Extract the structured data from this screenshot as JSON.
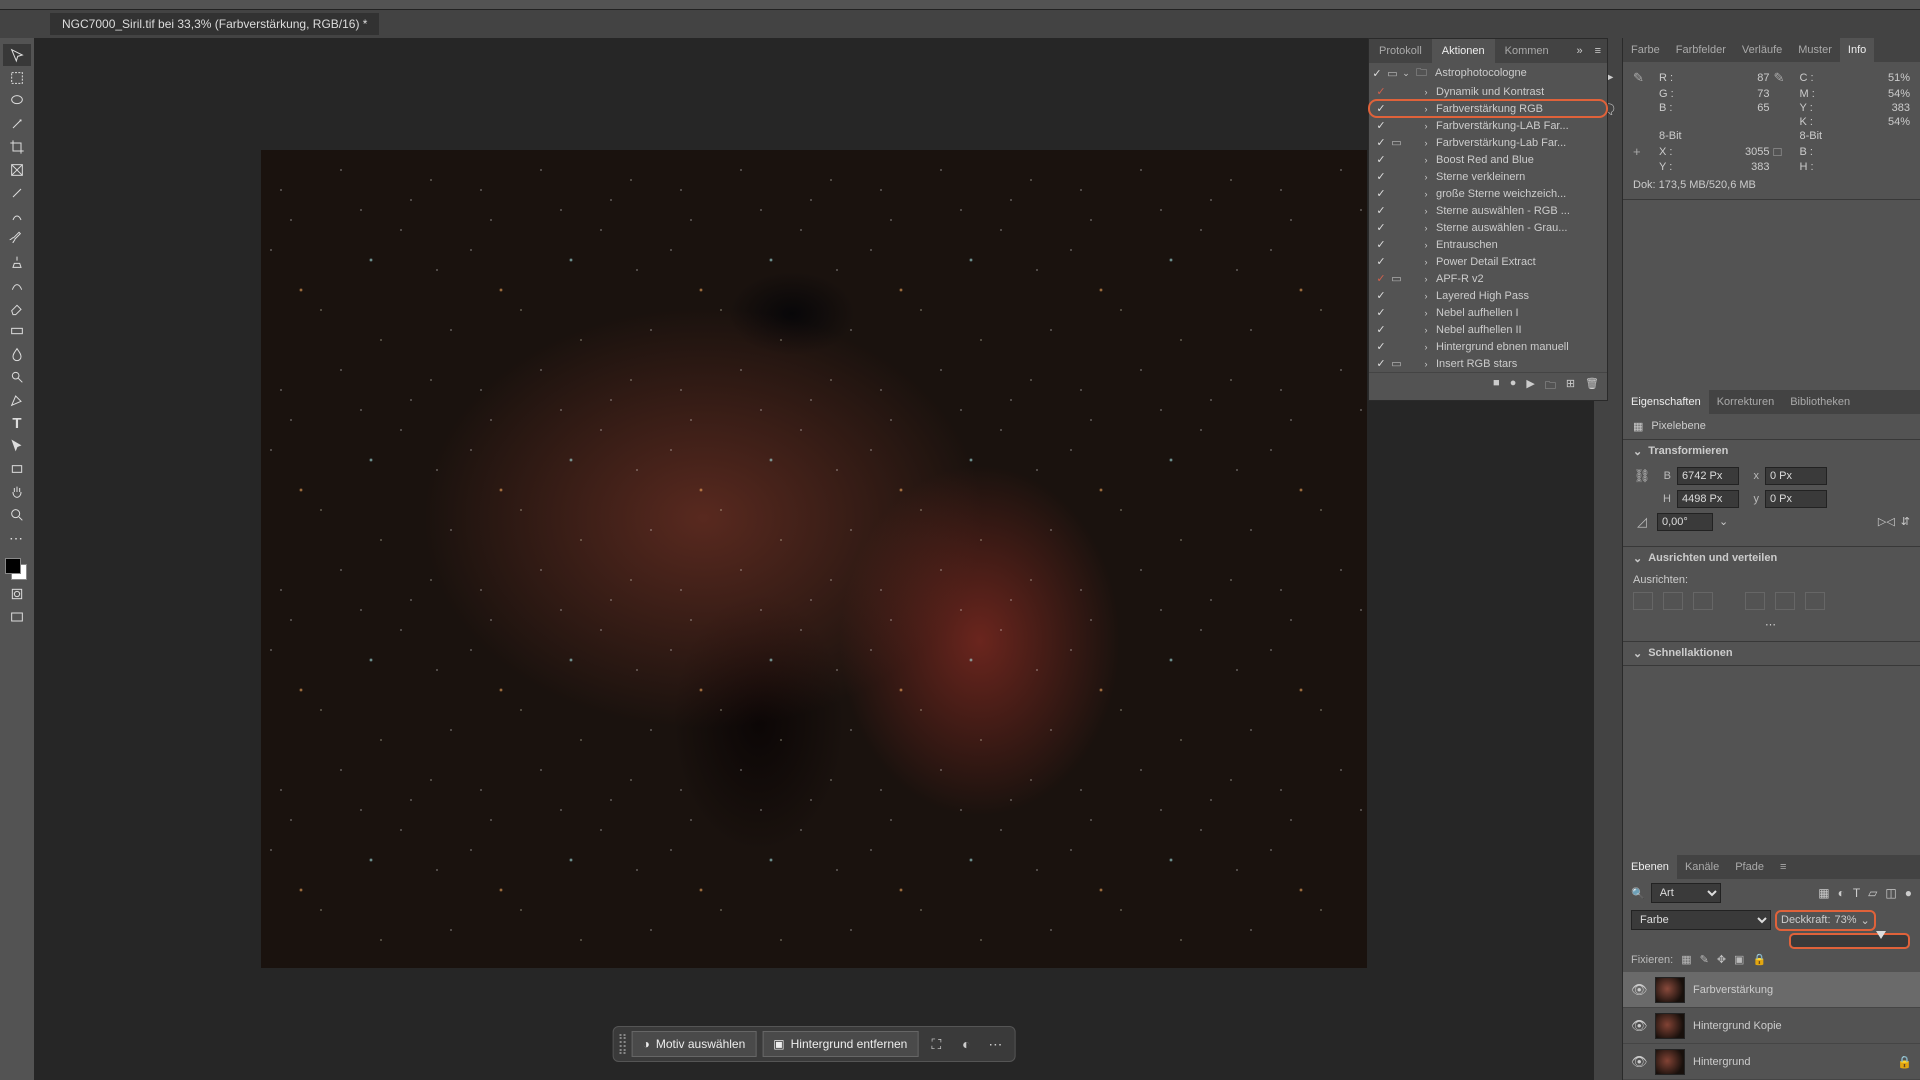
{
  "tab_title": "NGC7000_Siril.tif bei 33,3% (Farbverstärkung, RGB/16) *",
  "actions": {
    "tabs": {
      "protokoll": "Protokoll",
      "aktionen": "Aktionen",
      "kommen": "Kommen"
    },
    "group": "Astrophotocologne",
    "items": [
      {
        "label": "Dynamik und Kontrast",
        "red_check": true
      },
      {
        "label": "Farbverstärkung RGB",
        "highlight": true
      },
      {
        "label": "Farbverstärkung-LAB Far..."
      },
      {
        "label": "Farbverstärkung-Lab Far...",
        "mode": true
      },
      {
        "label": "Boost Red and Blue"
      },
      {
        "label": "Sterne verkleinern"
      },
      {
        "label": "große Sterne weichzeich..."
      },
      {
        "label": "Sterne auswählen - RGB ..."
      },
      {
        "label": "Sterne auswählen - Grau..."
      },
      {
        "label": "Entrauschen"
      },
      {
        "label": "Power Detail Extract"
      },
      {
        "label": "APF-R v2",
        "red_check": true,
        "mode": true
      },
      {
        "label": "Layered High Pass"
      },
      {
        "label": "Nebel aufhellen I"
      },
      {
        "label": "Nebel aufhellen II"
      },
      {
        "label": "Hintergrund ebnen manuell"
      },
      {
        "label": "Insert RGB stars",
        "mode": true
      }
    ]
  },
  "color_tabs": {
    "farbe": "Farbe",
    "farbfelder": "Farbfelder",
    "verlaufe": "Verläufe",
    "muster": "Muster",
    "info": "Info"
  },
  "info": {
    "r": "87",
    "g": "73",
    "b": "65",
    "c": "51%",
    "m": "54%",
    "y": "383",
    "k": "54%",
    "bit_left": "8-Bit",
    "bit_right": "8-Bit",
    "x": "3055",
    "wlbl": "B :",
    "hlbl": "H :",
    "doc": "Dok: 173,5 MB/520,6 MB"
  },
  "props_tabs": {
    "eigenschaften": "Eigenschaften",
    "korrekturen": "Korrekturen",
    "bibliotheken": "Bibliotheken"
  },
  "props": {
    "layer_kind": "Pixelebene",
    "transform_head": "Transformieren",
    "w": "6742 Px",
    "h": "4498 Px",
    "x": "0 Px",
    "y": "0 Px",
    "angle": "0,00°",
    "align_head": "Ausrichten und verteilen",
    "align_label": "Ausrichten:",
    "quick_head": "Schnellaktionen"
  },
  "layers_tabs": {
    "ebenen": "Ebenen",
    "kanale": "Kanäle",
    "pfade": "Pfade"
  },
  "layers": {
    "filter_label": "Art",
    "blend_label": "Farbe",
    "opacity_label": "Deckkraft:",
    "opacity_value": "73%",
    "lock_label": "Fixieren:",
    "items": [
      {
        "name": "Farbverstärkung",
        "selected": true
      },
      {
        "name": "Hintergrund Kopie"
      },
      {
        "name": "Hintergrund",
        "locked": true
      }
    ]
  },
  "ctx": {
    "select_subject": "Motiv auswählen",
    "remove_bg": "Hintergrund entfernen"
  },
  "labels": {
    "b": "B",
    "h": "H",
    "x": "x",
    "y": "y",
    "r": "R :",
    "g": "G :",
    "bl": "B :",
    "c": "C :",
    "m": "M :",
    "yl": "Y :",
    "k": "K :",
    "xl": "X :",
    "ylc": "Y :"
  }
}
